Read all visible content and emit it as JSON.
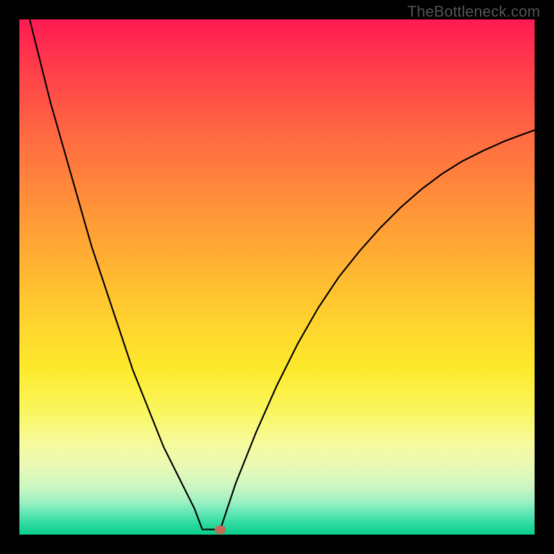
{
  "watermark": "TheBottleneck.com",
  "colors": {
    "frame": "#000000",
    "curve": "#000000",
    "marker": "#c46a59",
    "gradient_top": "#ff1a52",
    "gradient_bottom": "#09cf8a"
  },
  "chart_data": {
    "type": "line",
    "title": "",
    "xlabel": "",
    "ylabel": "",
    "xlim": [
      0,
      100
    ],
    "ylim": [
      0,
      100
    ],
    "notch_x": 37,
    "notch_floor_y": 1,
    "marker": {
      "x": 39,
      "y": 1
    },
    "series": [
      {
        "name": "left-branch",
        "x": [
          0,
          2,
          4,
          6,
          8,
          10,
          12,
          14,
          16,
          18,
          20,
          22,
          24,
          26,
          28,
          30,
          32,
          34,
          35.5
        ],
        "values": [
          108,
          100,
          92,
          84,
          77,
          70,
          63,
          56,
          50,
          44,
          38,
          32,
          27,
          22,
          17,
          13,
          9,
          5,
          1
        ]
      },
      {
        "name": "floor",
        "x": [
          35.5,
          39
        ],
        "values": [
          1,
          1
        ]
      },
      {
        "name": "right-branch",
        "x": [
          39,
          42,
          46,
          50,
          54,
          58,
          62,
          66,
          70,
          74,
          78,
          82,
          86,
          90,
          94,
          98,
          100
        ],
        "values": [
          1,
          10,
          20,
          29,
          37,
          44,
          50,
          55,
          59.5,
          63.5,
          67,
          70,
          72.5,
          74.5,
          76.3,
          77.8,
          78.5
        ]
      }
    ]
  }
}
